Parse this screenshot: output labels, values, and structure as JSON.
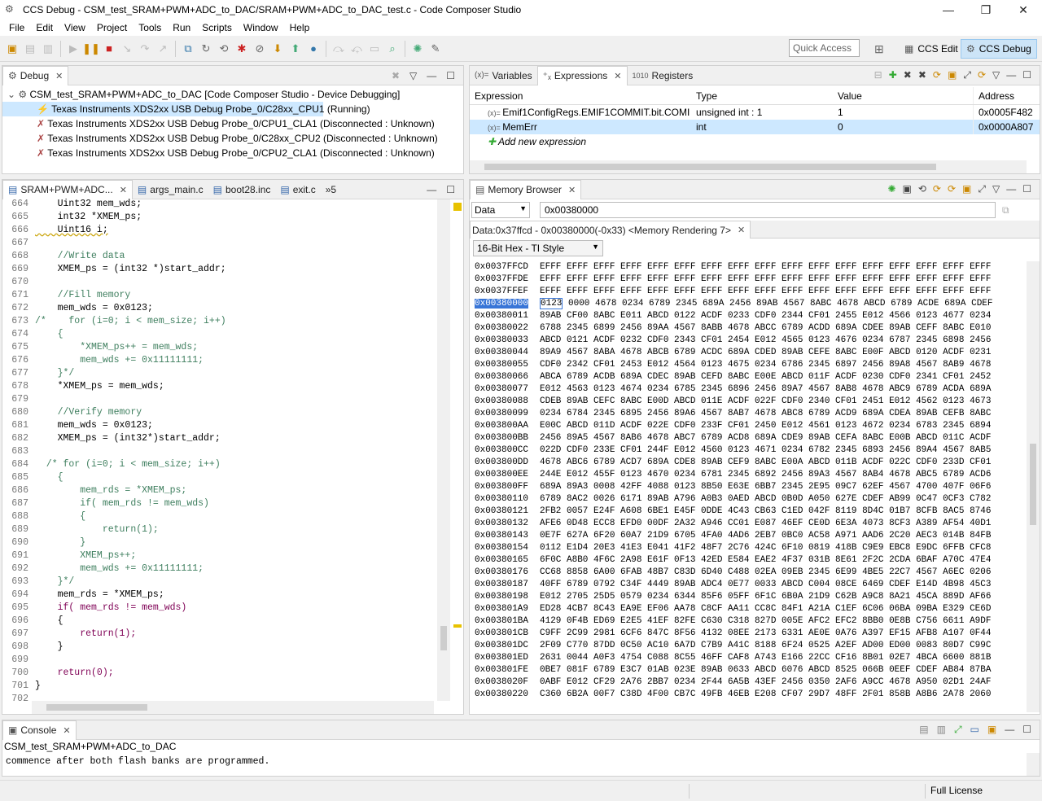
{
  "window": {
    "title": "CCS Debug - CSM_test_SRAM+PWM+ADC_to_DAC/SRAM+PWM+ADC_to_DAC_test.c - Code Composer Studio",
    "minimize": "—",
    "restore": "❐",
    "close": "✕"
  },
  "menu": [
    "File",
    "Edit",
    "View",
    "Project",
    "Tools",
    "Run",
    "Scripts",
    "Window",
    "Help"
  ],
  "toolbar": {
    "quick_access": "Quick Access",
    "persp_edit": "CCS Edit",
    "persp_debug": "CCS Debug"
  },
  "debug": {
    "tab": "Debug",
    "items": [
      "CSM_test_SRAM+PWM+ADC_to_DAC [Code Composer Studio - Device Debugging]",
      "Texas Instruments XDS2xx USB Debug Probe_0/C28xx_CPU1 (Running)",
      "Texas Instruments XDS2xx USB Debug Probe_0/CPU1_CLA1 (Disconnected : Unknown)",
      "Texas Instruments XDS2xx USB Debug Probe_0/C28xx_CPU2 (Disconnected : Unknown)",
      "Texas Instruments XDS2xx USB Debug Probe_0/CPU2_CLA1 (Disconnected : Unknown)"
    ]
  },
  "expr": {
    "tabs": [
      "Variables",
      "Expressions",
      "Registers"
    ],
    "headers": [
      "Expression",
      "Type",
      "Value",
      "Address"
    ],
    "rows": [
      [
        "Emif1ConfigRegs.EMIF1COMMIT.bit.COMI",
        "unsigned int : 1",
        "1",
        "0x0005F482"
      ],
      [
        "MemErr",
        "int",
        "0",
        "0x0000A807"
      ]
    ],
    "add": "Add new expression"
  },
  "editor": {
    "tabs": [
      "SRAM+PWM+ADC...",
      "args_main.c",
      "boot28.inc",
      "exit.c",
      "»5"
    ],
    "lines": [
      [
        "664",
        "    Uint32 mem_wds;"
      ],
      [
        "665",
        "    int32 *XMEM_ps;"
      ],
      [
        "666",
        "    Uint16 i;"
      ],
      [
        "667",
        ""
      ],
      [
        "668",
        "    //Write data"
      ],
      [
        "669",
        "    XMEM_ps = (int32 *)start_addr;"
      ],
      [
        "670",
        ""
      ],
      [
        "671",
        "    //Fill memory"
      ],
      [
        "672",
        "    mem_wds = 0x0123;"
      ],
      [
        "673",
        "/*    for (i=0; i < mem_size; i++)"
      ],
      [
        "674",
        "    {"
      ],
      [
        "675",
        "        *XMEM_ps++ = mem_wds;"
      ],
      [
        "676",
        "        mem_wds += 0x11111111;"
      ],
      [
        "677",
        "    }*/"
      ],
      [
        "678",
        "    *XMEM_ps = mem_wds;"
      ],
      [
        "679",
        ""
      ],
      [
        "680",
        "    //Verify memory"
      ],
      [
        "681",
        "    mem_wds = 0x0123;"
      ],
      [
        "682",
        "    XMEM_ps = (int32*)start_addr;"
      ],
      [
        "683",
        ""
      ],
      [
        "684",
        "  /* for (i=0; i < mem_size; i++)"
      ],
      [
        "685",
        "    {"
      ],
      [
        "686",
        "        mem_rds = *XMEM_ps;"
      ],
      [
        "687",
        "        if( mem_rds != mem_wds)"
      ],
      [
        "688",
        "        {"
      ],
      [
        "689",
        "            return(1);"
      ],
      [
        "690",
        "        }"
      ],
      [
        "691",
        "        XMEM_ps++;"
      ],
      [
        "692",
        "        mem_wds += 0x11111111;"
      ],
      [
        "693",
        "    }*/"
      ],
      [
        "694",
        "    mem_rds = *XMEM_ps;"
      ],
      [
        "695",
        "    if( mem_rds != mem_wds)"
      ],
      [
        "696",
        "    {"
      ],
      [
        "697",
        "        return(1);"
      ],
      [
        "698",
        "    }"
      ],
      [
        "699",
        ""
      ],
      [
        "700",
        "    return(0);"
      ],
      [
        "701",
        "}"
      ],
      [
        "702",
        ""
      ]
    ]
  },
  "memory": {
    "tab": "Memory Browser",
    "space": "Data",
    "address": "0x00380000",
    "rendering_tab": "Data:0x37ffcd - 0x00380000(-0x33) <Memory Rendering 7>",
    "format": "16-Bit Hex - TI Style",
    "rows": [
      [
        "0x0037FFCD",
        "EFFF EFFF EFFF EFFF EFFF EFFF EFFF EFFF EFFF EFFF EFFF EFFF EFFF EFFF EFFF EFFF EFFF"
      ],
      [
        "0x0037FFDE",
        "EFFF EFFF EFFF EFFF EFFF EFFF EFFF EFFF EFFF EFFF EFFF EFFF EFFF EFFF EFFF EFFF EFFF"
      ],
      [
        "0x0037FFEF",
        "EFFF EFFF EFFF EFFF EFFF EFFF EFFF EFFF EFFF EFFF EFFF EFFF EFFF EFFF EFFF EFFF EFFF"
      ],
      [
        "0x00380000",
        "0123 0000 4678 0234 6789 2345 689A 2456 89AB 4567 8ABC 4678 ABCD 6789 ACDE 689A CDEF"
      ],
      [
        "0x00380011",
        "89AB CF00 8ABC E011 ABCD 0122 ACDF 0233 CDF0 2344 CF01 2455 E012 4566 0123 4677 0234"
      ],
      [
        "0x00380022",
        "6788 2345 6899 2456 89AA 4567 8ABB 4678 ABCC 6789 ACDD 689A CDEE 89AB CEFF 8ABC E010"
      ],
      [
        "0x00380033",
        "ABCD 0121 ACDF 0232 CDF0 2343 CF01 2454 E012 4565 0123 4676 0234 6787 2345 6898 2456"
      ],
      [
        "0x00380044",
        "89A9 4567 8ABA 4678 ABCB 6789 ACDC 689A CDED 89AB CEFE 8ABC E00F ABCD 0120 ACDF 0231"
      ],
      [
        "0x00380055",
        "CDF0 2342 CF01 2453 E012 4564 0123 4675 0234 6786 2345 6897 2456 89A8 4567 8AB9 4678"
      ],
      [
        "0x00380066",
        "ABCA 6789 ACDB 689A CDEC 89AB CEFD 8ABC E00E ABCD 011F ACDF 0230 CDF0 2341 CF01 2452"
      ],
      [
        "0x00380077",
        "E012 4563 0123 4674 0234 6785 2345 6896 2456 89A7 4567 8AB8 4678 ABC9 6789 ACDA 689A"
      ],
      [
        "0x00380088",
        "CDEB 89AB CEFC 8ABC E00D ABCD 011E ACDF 022F CDF0 2340 CF01 2451 E012 4562 0123 4673"
      ],
      [
        "0x00380099",
        "0234 6784 2345 6895 2456 89A6 4567 8AB7 4678 ABC8 6789 ACD9 689A CDEA 89AB CEFB 8ABC"
      ],
      [
        "0x003800AA",
        "E00C ABCD 011D ACDF 022E CDF0 233F CF01 2450 E012 4561 0123 4672 0234 6783 2345 6894"
      ],
      [
        "0x003800BB",
        "2456 89A5 4567 8AB6 4678 ABC7 6789 ACD8 689A CDE9 89AB CEFA 8ABC E00B ABCD 011C ACDF"
      ],
      [
        "0x003800CC",
        "022D CDF0 233E CF01 244F E012 4560 0123 4671 0234 6782 2345 6893 2456 89A4 4567 8AB5"
      ],
      [
        "0x003800DD",
        "4678 ABC6 6789 ACD7 689A CDE8 89AB CEF9 8ABC E00A ABCD 011B ACDF 022C CDF0 233D CF01"
      ],
      [
        "0x003800EE",
        "244E E012 455F 0123 4670 0234 6781 2345 6892 2456 89A3 4567 8AB4 4678 ABC5 6789 ACD6"
      ],
      [
        "0x003800FF",
        "689A 89A3 0008 42FF 4088 0123 8B50 E63E 6BB7 2345 2E95 09C7 62EF 4567 4700 407F 06F6"
      ],
      [
        "0x00380110",
        "6789 8AC2 0026 6171 89AB A796 A0B3 0AED ABCD 0B0D A050 627E CDEF AB99 0C47 0CF3 C782"
      ],
      [
        "0x00380121",
        "2FB2 0057 E24F A608 6BE1 E45F 0DDE 4C43 CB63 C1ED 042F 8119 8D4C 01B7 8CFB 8AC5 8746"
      ],
      [
        "0x00380132",
        "AFE6 0D48 ECC8 EFD0 00DF 2A32 A946 CC01 E087 46EF CE0D 6E3A 4073 8CF3 A389 AF54 40D1"
      ],
      [
        "0x00380143",
        "0E7F 627A 6F20 60A7 21D9 6705 4FA0 4AD6 2EB7 0BC0 AC58 A971 AAD6 2C20 AEC3 014B 84FB"
      ],
      [
        "0x00380154",
        "0112 E1D4 20E3 41E3 E041 41F2 48F7 2C76 424C 6F10 0819 418B C9E9 EBC8 E9DC 6FFB CFC8"
      ],
      [
        "0x00380165",
        "6F0C A8B0 4F6C 2A98 E61F 0F13 42ED E584 EAE2 4F37 031B 8E61 2F2C 2CDA 6BAF A70C 47E4"
      ],
      [
        "0x00380176",
        "CC68 8858 6A00 6FAB 48B7 C83D 6D40 C488 02EA 09EB 2345 6E99 4BE5 22C7 4567 A6EC 0206"
      ],
      [
        "0x00380187",
        "40FF 6789 0792 C34F 4449 89AB ADC4 0E77 0033 ABCD C004 08CE 6469 CDEF E14D 4B98 45C3"
      ],
      [
        "0x00380198",
        "E012 2705 25D5 0579 0234 6344 85F6 05FF 6F1C 6B0A 21D9 C62B A9C8 8A21 45CA 889D AF66"
      ],
      [
        "0x003801A9",
        "ED28 4CB7 8C43 EA9E EF06 AA78 C8CF AA11 CC8C 84F1 A21A C1EF 6C06 06BA 09BA E329 CE6D"
      ],
      [
        "0x003801BA",
        "4129 0F4B ED69 E2E5 41EF 82FE C630 C318 827D 005E AFC2 EFC2 8BB0 0E8B C756 6611 A9DF"
      ],
      [
        "0x003801CB",
        "C9FF 2C99 2981 6CF6 847C 8F56 4132 08EE 2173 6331 AE0E 0A76 A397 EF15 AFB8 A107 0F44"
      ],
      [
        "0x003801DC",
        "2F09 C770 87DD 0C50 AC10 6A7D C7B9 A41C 8188 6F24 0525 A2EF AD00 ED00 0083 80D7 C99C"
      ],
      [
        "0x003801ED",
        "2631 0044 A0F3 4754 C088 8C55 46FF CAF8 A743 E166 22CC CF16 8B01 02E7 4BCA 6600 881B"
      ],
      [
        "0x003801FE",
        "0BE7 081F 6789 E3C7 01AB 023E 89AB 0633 ABCD 6076 ABCD 8525 066B 0EEF CDEF AB84 87BA"
      ],
      [
        "0x0038020F",
        "0ABF E012 CF29 2A76 2BB7 0234 2F44 6A5B 43EF 2456 0350 2AF6 A9CC 4678 A950 02D1 24AF"
      ],
      [
        "0x00380220",
        "C360 6B2A 00F7 C38D 4F00 CB7C 49FB 46EB E208 CF07 29D7 48FF 2F01 858B A8B6 2A78 2060"
      ]
    ]
  },
  "console": {
    "tab": "Console",
    "context": "CSM_test_SRAM+PWM+ADC_to_DAC",
    "text": "commence after both flash banks are programmed."
  },
  "status": {
    "license": "Full License"
  }
}
